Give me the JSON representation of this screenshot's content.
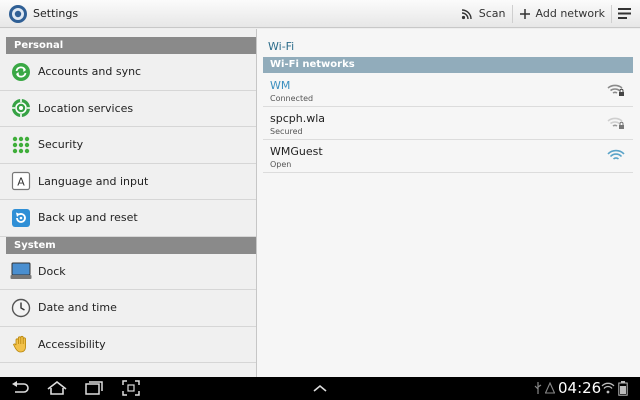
{
  "app": {
    "title": "Settings"
  },
  "actionbar": {
    "scan_label": "Scan",
    "add_network_label": "Add network"
  },
  "sidebar": {
    "sections": [
      {
        "header": "Personal",
        "items": [
          {
            "label": "Accounts and sync",
            "icon": "sync-icon"
          },
          {
            "label": "Location services",
            "icon": "location-icon"
          },
          {
            "label": "Security",
            "icon": "security-grid-icon"
          },
          {
            "label": "Language and input",
            "icon": "keyboard-a-icon"
          },
          {
            "label": "Back up and reset",
            "icon": "backup-icon"
          }
        ]
      },
      {
        "header": "System",
        "items": [
          {
            "label": "Dock",
            "icon": "dock-icon"
          },
          {
            "label": "Date and time",
            "icon": "clock-icon"
          },
          {
            "label": "Accessibility",
            "icon": "hand-icon"
          }
        ]
      }
    ]
  },
  "wifi": {
    "title": "Wi-Fi",
    "networks_header": "Wi-Fi networks",
    "networks": [
      {
        "name": "WM",
        "status": "Connected",
        "secured": true,
        "signal": 0.75
      },
      {
        "name": "spcph.wla",
        "status": "Secured",
        "secured": true,
        "signal": 0.25
      },
      {
        "name": "WMGuest",
        "status": "Open",
        "secured": false,
        "signal": 0.75
      }
    ]
  },
  "statusbar": {
    "time": "04:26"
  },
  "colors": {
    "accent": "#3b8fbf",
    "section_header": "#8a8a8a",
    "network_header": "#91acbb"
  }
}
